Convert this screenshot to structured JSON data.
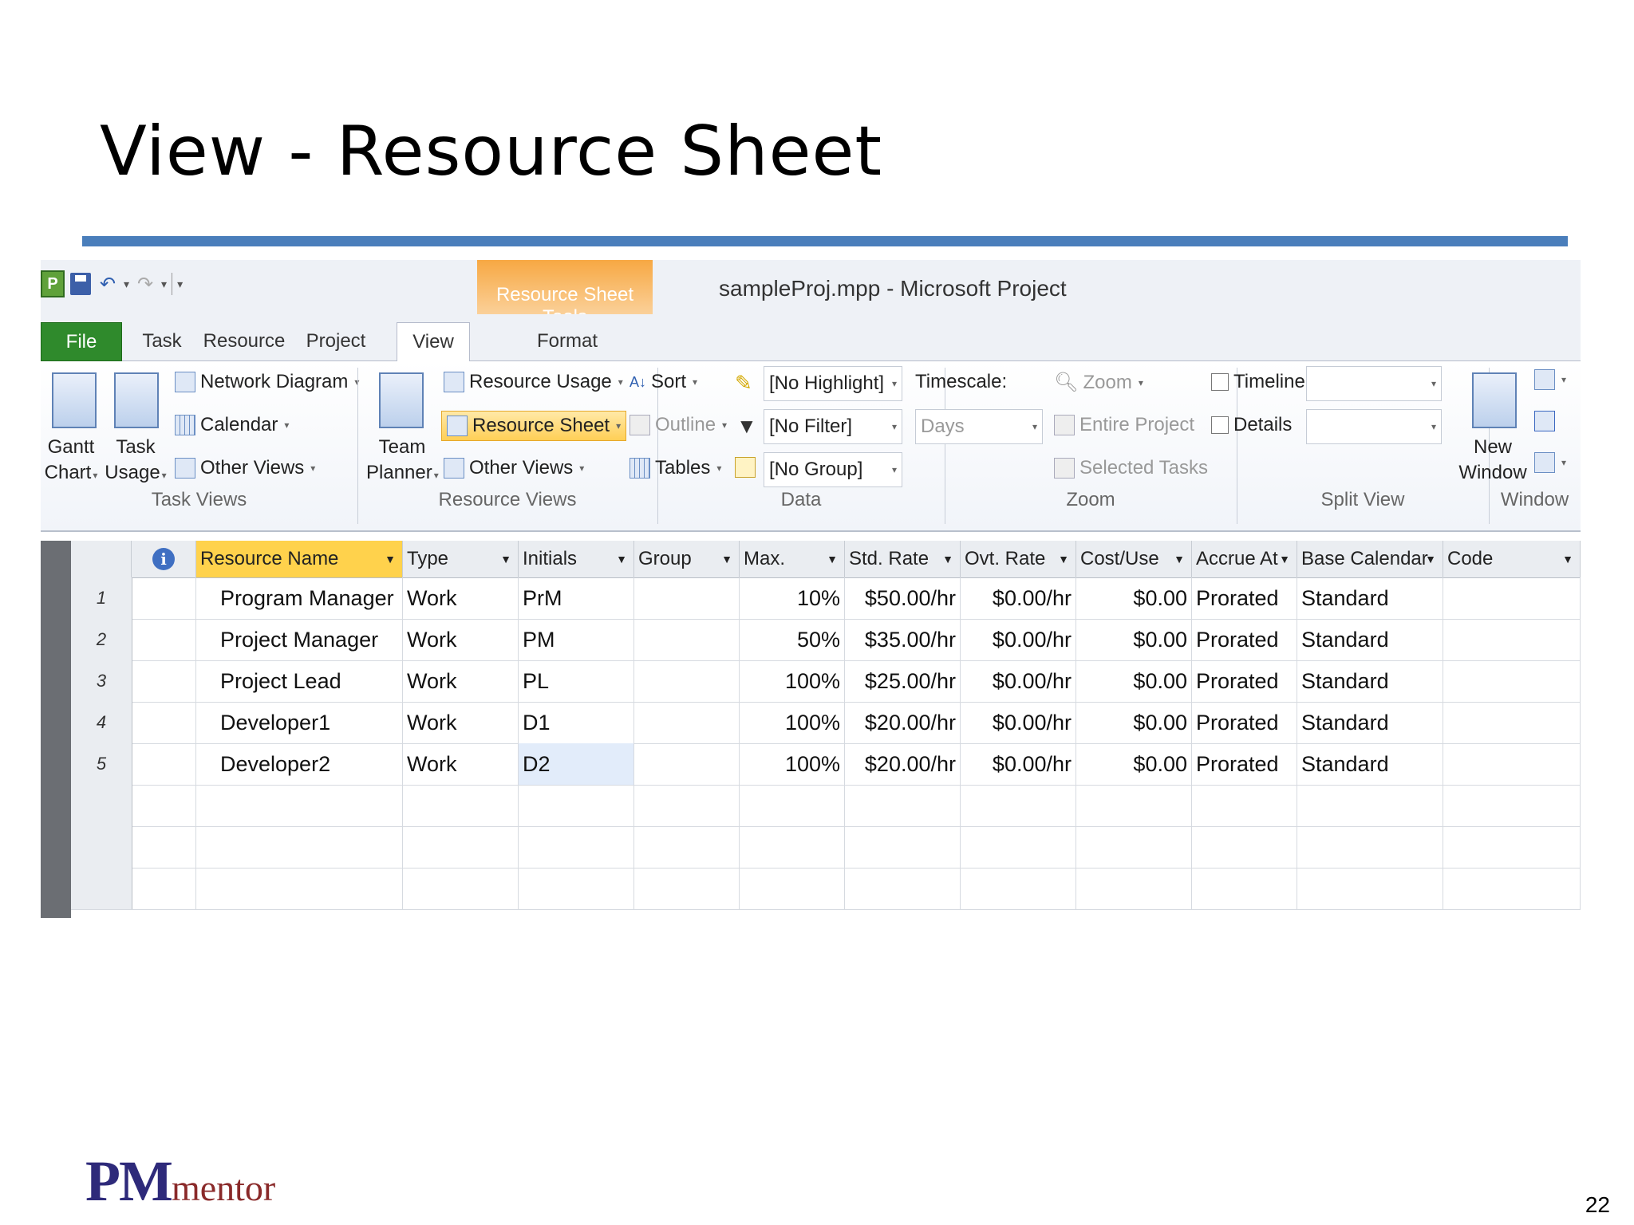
{
  "slide": {
    "title": "View - Resource Sheet",
    "page_number": "22",
    "logo_pm": "PM",
    "logo_mentor": "mentor",
    "rule_color": "#4a7ebb"
  },
  "app": {
    "window_title": "sampleProj.mpp  -  Microsoft Project",
    "contextual_tab": "Resource Sheet Tools",
    "tabs": [
      "File",
      "Task",
      "Resource",
      "Project",
      "View",
      "Format"
    ],
    "active_tab": "View",
    "ribbon": {
      "task_views": {
        "label": "Task Views",
        "gantt_chart": [
          "Gantt",
          "Chart"
        ],
        "task_usage": [
          "Task",
          "Usage"
        ],
        "network_diagram": "Network Diagram",
        "calendar": "Calendar",
        "other_views": "Other Views"
      },
      "resource_views": {
        "label": "Resource Views",
        "team_planner": [
          "Team",
          "Planner"
        ],
        "resource_usage": "Resource Usage",
        "resource_sheet": "Resource Sheet",
        "other_views": "Other Views"
      },
      "data": {
        "label": "Data",
        "sort": "Sort",
        "outline": "Outline",
        "tables": "Tables",
        "highlight": "[No Highlight]",
        "filter": "[No Filter]",
        "group": "[No Group]"
      },
      "zoom": {
        "label": "Zoom",
        "timescale": "Timescale:",
        "timescale_value": "Days",
        "zoom": "Zoom",
        "entire_project": "Entire Project",
        "selected_tasks": "Selected Tasks"
      },
      "split_view": {
        "label": "Split View",
        "timeline": "Timeline",
        "details": "Details"
      },
      "window": {
        "label": "Window",
        "new_window": [
          "New",
          "Window"
        ]
      }
    },
    "table": {
      "columns": [
        "Resource Name",
        "Type",
        "Initials",
        "Group",
        "Max.",
        "Std. Rate",
        "Ovt. Rate",
        "Cost/Use",
        "Accrue At",
        "Base Calendar",
        "Code"
      ],
      "rows": [
        {
          "id": "1",
          "name": "Program Manager",
          "type": "Work",
          "initials": "PrM",
          "group": "",
          "max": "10%",
          "std_rate": "$50.00/hr",
          "ovt_rate": "$0.00/hr",
          "cost_use": "$0.00",
          "accrue": "Prorated",
          "calendar": "Standard",
          "code": ""
        },
        {
          "id": "2",
          "name": "Project Manager",
          "type": "Work",
          "initials": "PM",
          "group": "",
          "max": "50%",
          "std_rate": "$35.00/hr",
          "ovt_rate": "$0.00/hr",
          "cost_use": "$0.00",
          "accrue": "Prorated",
          "calendar": "Standard",
          "code": ""
        },
        {
          "id": "3",
          "name": "Project Lead",
          "type": "Work",
          "initials": "PL",
          "group": "",
          "max": "100%",
          "std_rate": "$25.00/hr",
          "ovt_rate": "$0.00/hr",
          "cost_use": "$0.00",
          "accrue": "Prorated",
          "calendar": "Standard",
          "code": ""
        },
        {
          "id": "4",
          "name": "Developer1",
          "type": "Work",
          "initials": "D1",
          "group": "",
          "max": "100%",
          "std_rate": "$20.00/hr",
          "ovt_rate": "$0.00/hr",
          "cost_use": "$0.00",
          "accrue": "Prorated",
          "calendar": "Standard",
          "code": ""
        },
        {
          "id": "5",
          "name": "Developer2",
          "type": "Work",
          "initials": "D2",
          "group": "",
          "max": "100%",
          "std_rate": "$20.00/hr",
          "ovt_rate": "$0.00/hr",
          "cost_use": "$0.00",
          "accrue": "Prorated",
          "calendar": "Standard",
          "code": ""
        }
      ],
      "empty_rows": 3
    }
  }
}
